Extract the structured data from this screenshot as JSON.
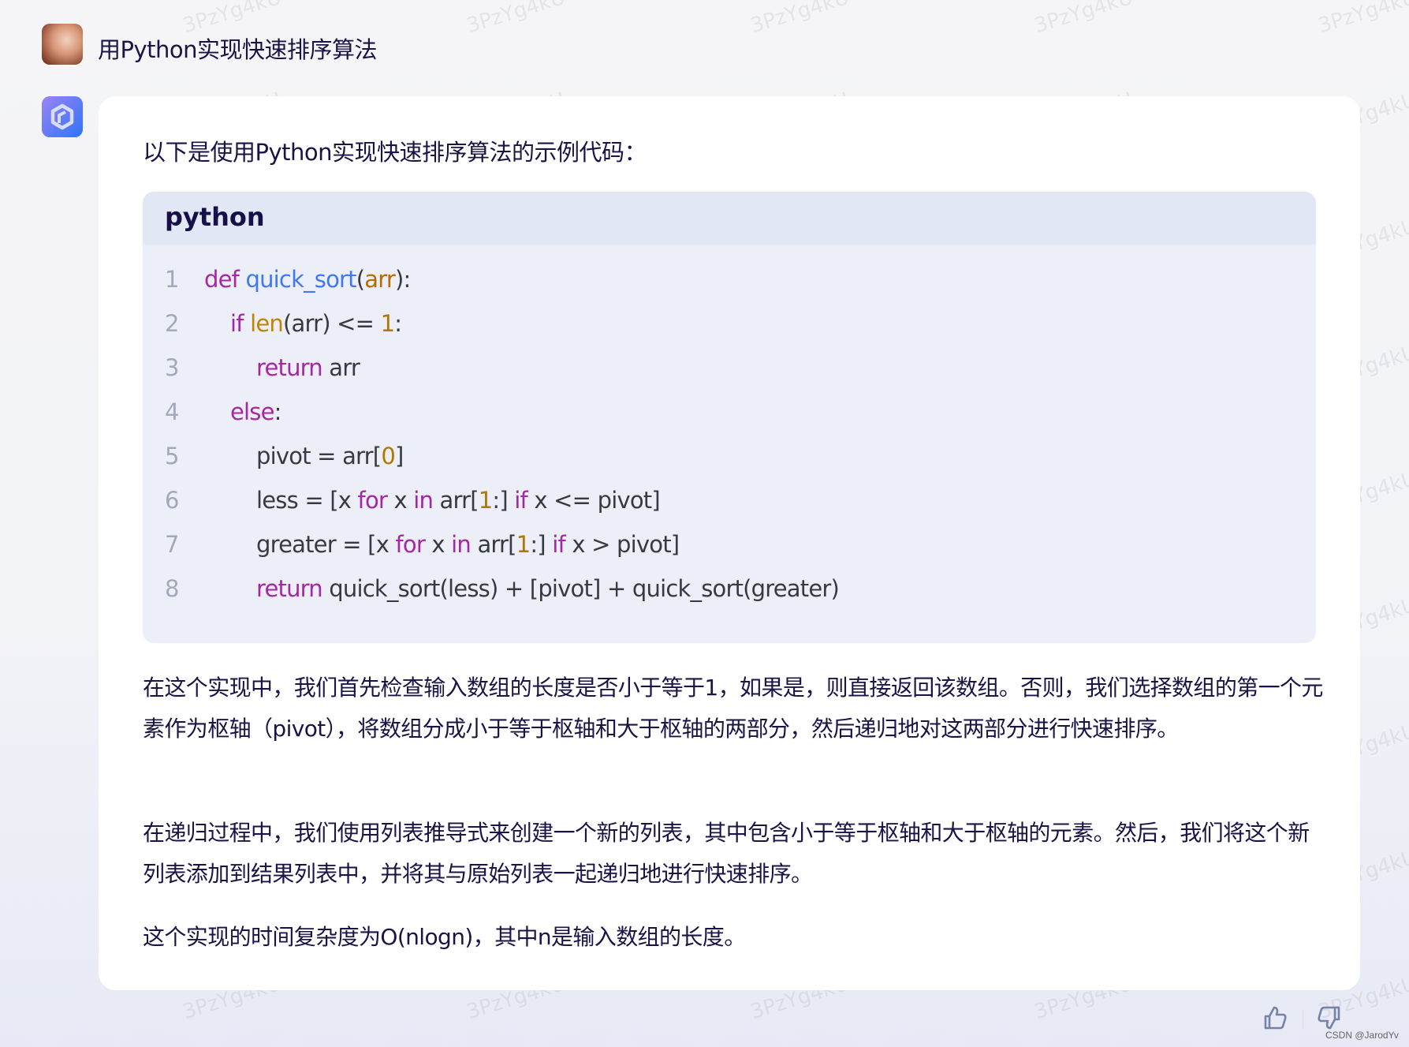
{
  "question": "用Python实现快速排序算法",
  "answer": {
    "intro": "以下是使用Python实现快速排序算法的示例代码：",
    "code": {
      "language": "python",
      "lines": [
        {
          "n": "1",
          "indent": 0,
          "tokens": [
            [
              "kw",
              "def "
            ],
            [
              "fn",
              "quick_sort"
            ],
            [
              "tx",
              "("
            ],
            [
              "pa",
              "arr"
            ],
            [
              "tx",
              "):"
            ]
          ]
        },
        {
          "n": "2",
          "indent": 1,
          "tokens": [
            [
              "kw",
              "if "
            ],
            [
              "bi",
              "len"
            ],
            [
              "tx",
              "(arr) <= "
            ],
            [
              "nu",
              "1"
            ],
            [
              "tx",
              ":"
            ]
          ]
        },
        {
          "n": "3",
          "indent": 2,
          "tokens": [
            [
              "kw",
              "return "
            ],
            [
              "tx",
              "arr"
            ]
          ]
        },
        {
          "n": "4",
          "indent": 1,
          "tokens": [
            [
              "kw",
              "else"
            ],
            [
              "tx",
              ":"
            ]
          ]
        },
        {
          "n": "5",
          "indent": 2,
          "tokens": [
            [
              "tx",
              "pivot = arr["
            ],
            [
              "nu",
              "0"
            ],
            [
              "tx",
              "]"
            ]
          ]
        },
        {
          "n": "6",
          "indent": 2,
          "tokens": [
            [
              "tx",
              "less = [x "
            ],
            [
              "kw",
              "for "
            ],
            [
              "tx",
              "x "
            ],
            [
              "kw",
              "in "
            ],
            [
              "tx",
              "arr["
            ],
            [
              "nu",
              "1"
            ],
            [
              "tx",
              ":] "
            ],
            [
              "kw",
              "if "
            ],
            [
              "tx",
              "x <= pivot]"
            ]
          ]
        },
        {
          "n": "7",
          "indent": 2,
          "tokens": [
            [
              "tx",
              "greater = [x "
            ],
            [
              "kw",
              "for "
            ],
            [
              "tx",
              "x "
            ],
            [
              "kw",
              "in "
            ],
            [
              "tx",
              "arr["
            ],
            [
              "nu",
              "1"
            ],
            [
              "tx",
              ":] "
            ],
            [
              "kw",
              "if "
            ],
            [
              "tx",
              "x > pivot]"
            ]
          ]
        },
        {
          "n": "8",
          "indent": 2,
          "tokens": [
            [
              "kw",
              "return "
            ],
            [
              "tx",
              "quick_sort(less) + [pivot] + quick_sort(greater)"
            ]
          ]
        }
      ]
    },
    "paragraphs": [
      "在这个实现中，我们首先检查输入数组的长度是否小于等于1，如果是，则直接返回该数组。否则，我们选择数组的第一个元素作为枢轴（pivot），将数组分成小于等于枢轴和大于枢轴的两部分，然后递归地对这两部分进行快速排序。",
      "在递归过程中，我们使用列表推导式来创建一个新的列表，其中包含小于等于枢轴和大于枢轴的元素。然后，我们将这个新列表添加到结果列表中，并将其与原始列表一起递归地进行快速排序。",
      "这个实现的时间复杂度为O(nlogn)，其中n是输入数组的长度。"
    ]
  },
  "feedback": {
    "like_icon": "thumbs-up-icon",
    "dislike_icon": "thumbs-down-icon"
  },
  "watermark": "3PzYg4kU",
  "credit": "CSDN @JarodYv"
}
